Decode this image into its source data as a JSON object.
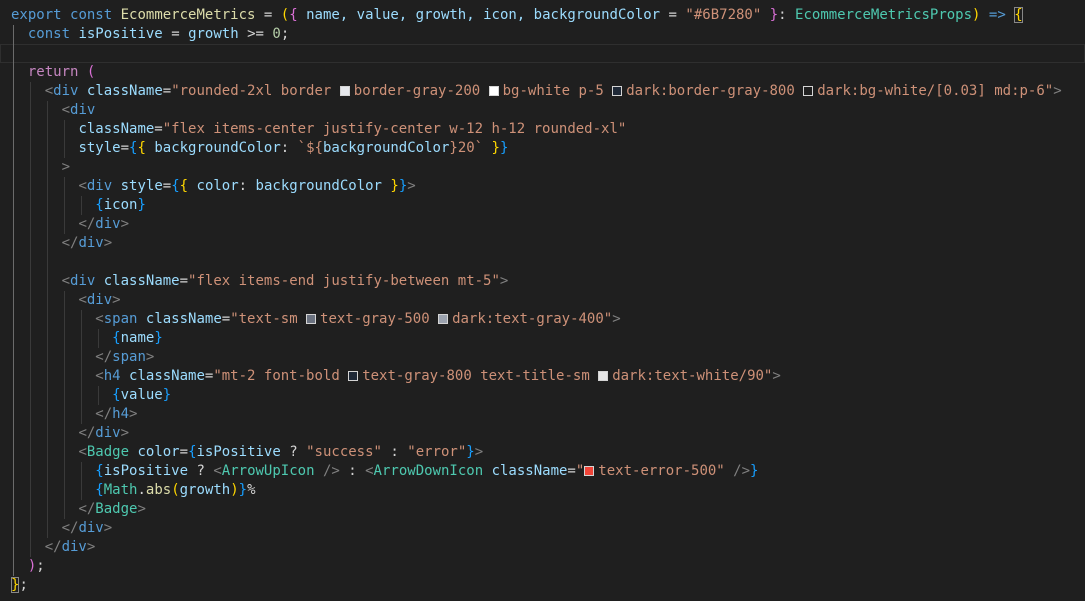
{
  "swatches": {
    "gray200": "#e5e7eb",
    "white": "#ffffff",
    "gray800": "#1f2937",
    "white003": "#1f1f1f",
    "gray500": "#6b7280",
    "gray400": "#9ca3af",
    "white90": "#e6e6e6",
    "error500": "#f04438"
  },
  "code": {
    "l1": {
      "export": "export",
      "const": "const",
      "name": "EcommerceMetrics",
      "eq": "=",
      "args": "name, value, growth, icon, backgroundColor",
      "default": "\"#6B7280\"",
      "type": "EcommerceMetricsProps",
      "arrow": "=>"
    },
    "l2": {
      "const": "const",
      "var": "isPositive",
      "eq": "=",
      "growth": "growth",
      "op": ">=",
      "num": "0"
    },
    "l4": {
      "return": "return"
    },
    "l5": {
      "div": "div",
      "attr": "className",
      "eq": "=",
      "s1": "\"rounded-2xl border ",
      "s2": "border-gray-200 ",
      "s3": "bg-white p-5 ",
      "s4": "dark:border-gray-800 ",
      "s5": "dark:bg-white/[0.03] md:p-6\""
    },
    "l6": {
      "div": "div"
    },
    "l7": {
      "attr": "className",
      "eq": "=",
      "str": "\"flex items-center justify-center w-12 h-12 rounded-xl\""
    },
    "l8": {
      "attr": "style",
      "eq": "=",
      "prop": "backgroundColor",
      "tpl1": "`${",
      "var": "backgroundColor",
      "tpl2": "}20`"
    },
    "l9": {
      "gt": ">"
    },
    "l10": {
      "div": "div",
      "attr": "style",
      "eq": "=",
      "prop": "color",
      "var": "backgroundColor"
    },
    "l11": {
      "var": "icon"
    },
    "l12": {
      "div": "div"
    },
    "l13": {
      "div": "div"
    },
    "l15": {
      "div": "div",
      "attr": "className",
      "eq": "=",
      "str": "\"flex items-end justify-between mt-5\""
    },
    "l16": {
      "div": "div"
    },
    "l17": {
      "span": "span",
      "attr": "className",
      "eq": "=",
      "s1": "\"text-sm ",
      "s2": "text-gray-500 ",
      "s3": "dark:text-gray-400\""
    },
    "l18": {
      "var": "name"
    },
    "l19": {
      "span": "span"
    },
    "l20": {
      "h4": "h4",
      "attr": "className",
      "eq": "=",
      "s1": "\"mt-2 font-bold ",
      "s2": "text-gray-800 text-title-sm ",
      "s3": "dark:text-white/90\""
    },
    "l21": {
      "var": "value"
    },
    "l22": {
      "h4": "h4"
    },
    "l23": {
      "div": "div"
    },
    "l24": {
      "badge": "Badge",
      "attr": "color",
      "eq": "=",
      "var": "isPositive",
      "q": "?",
      "s1": "\"success\"",
      "colon": ":",
      "s2": "\"error\""
    },
    "l25": {
      "var": "isPositive",
      "q": "?",
      "up": "ArrowUpIcon",
      "colon": ":",
      "down": "ArrowDownIcon",
      "attr": "className",
      "eq": "=",
      "s1": "\"",
      "s2": "text-error-500\""
    },
    "l26": {
      "math": "Math",
      "dot": ".",
      "abs": "abs",
      "var": "growth",
      "pct": "%"
    },
    "l27": {
      "badge": "Badge"
    },
    "l28": {
      "div": "div"
    },
    "l29": {
      "div": "div"
    },
    "l30": {
      "close": ");"
    },
    "l31": {
      "close": "};"
    }
  }
}
